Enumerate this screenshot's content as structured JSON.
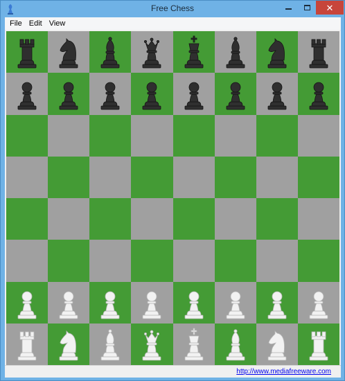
{
  "window": {
    "title": "Free Chess"
  },
  "menu": {
    "items": [
      "File",
      "Edit",
      "View"
    ]
  },
  "board": {
    "squares_top_left": "green",
    "colors": {
      "green": "#449b35",
      "gray": "#a0a0a0"
    },
    "piece_colors": {
      "black": "#2f2f2f",
      "white": "#f2f2f2"
    },
    "ranks": [
      [
        "black-rook",
        "black-knight",
        "black-bishop",
        "black-queen",
        "black-king",
        "black-bishop",
        "black-knight",
        "black-rook"
      ],
      [
        "black-pawn",
        "black-pawn",
        "black-pawn",
        "black-pawn",
        "black-pawn",
        "black-pawn",
        "black-pawn",
        "black-pawn"
      ],
      [
        "",
        "",
        "",
        "",
        "",
        "",
        "",
        ""
      ],
      [
        "",
        "",
        "",
        "",
        "",
        "",
        "",
        ""
      ],
      [
        "",
        "",
        "",
        "",
        "",
        "",
        "",
        ""
      ],
      [
        "",
        "",
        "",
        "",
        "",
        "",
        "",
        ""
      ],
      [
        "white-pawn",
        "white-pawn",
        "white-pawn",
        "white-pawn",
        "white-pawn",
        "white-pawn",
        "white-pawn",
        "white-pawn"
      ],
      [
        "white-rook",
        "white-knight",
        "white-bishop",
        "white-queen",
        "white-king",
        "white-bishop",
        "white-knight",
        "white-rook"
      ]
    ]
  },
  "status": {
    "link": "http://www.mediafreeware.com"
  }
}
